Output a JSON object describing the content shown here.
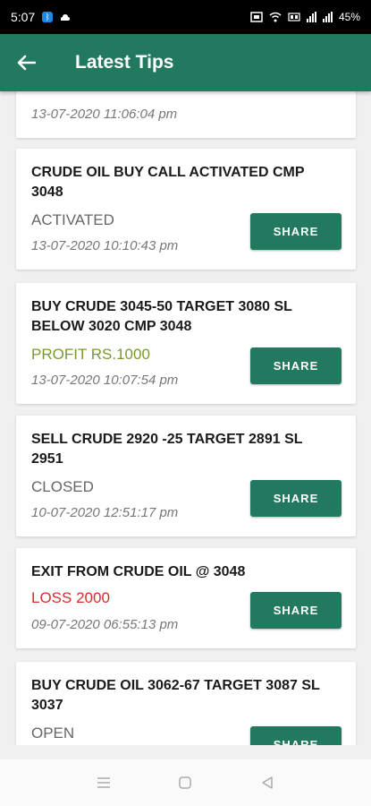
{
  "status_bar": {
    "time": "5:07",
    "battery": "45%"
  },
  "app_bar": {
    "title": "Latest Tips"
  },
  "share_label": "SHARE",
  "tips": [
    {
      "text": "",
      "status": "",
      "status_color": "#666666",
      "date": "13-07-2020 11:06:04 pm"
    },
    {
      "text": "CRUDE OIL BUY CALL ACTIVATED CMP 3048",
      "status": "ACTIVATED",
      "status_color": "#666666",
      "date": "13-07-2020 10:10:43 pm"
    },
    {
      "text": "BUY CRUDE 3045-50 TARGET 3080 SL BELOW 3020 CMP 3048",
      "status": "PROFIT RS.1000",
      "status_color": "#7a9a2a",
      "date": "13-07-2020 10:07:54 pm"
    },
    {
      "text": "SELL CRUDE 2920 -25 TARGET 2891 SL 2951",
      "status": "CLOSED",
      "status_color": "#666666",
      "date": "10-07-2020 12:51:17 pm"
    },
    {
      "text": "EXIT FROM CRUDE OIL @ 3048",
      "status": "LOSS 2000",
      "status_color": "#d32f2f",
      "date": "09-07-2020 06:55:13 pm"
    },
    {
      "text": "BUY CRUDE OIL 3062-67 TARGET 3087 SL 3037",
      "status": "OPEN",
      "status_color": "#666666",
      "date": ""
    }
  ]
}
